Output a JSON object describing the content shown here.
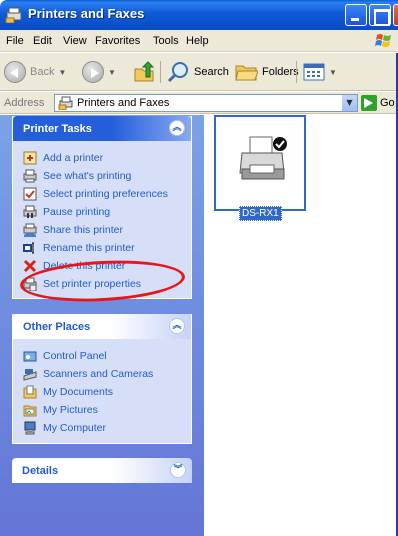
{
  "window": {
    "title": "Printers and Faxes"
  },
  "menu": [
    "File",
    "Edit",
    "View",
    "Favorites",
    "Tools",
    "Help"
  ],
  "toolbar": {
    "back": "Back",
    "search": "Search",
    "folders": "Folders"
  },
  "address": {
    "label": "Address",
    "value": "Printers and Faxes",
    "go": "Go"
  },
  "printer_tasks": {
    "title": "Printer Tasks",
    "items": [
      {
        "label": "Add a printer",
        "icon": "add-printer-icon"
      },
      {
        "label": "See what's printing",
        "icon": "print-queue-icon"
      },
      {
        "label": "Select printing preferences",
        "icon": "preferences-icon"
      },
      {
        "label": "Pause printing",
        "icon": "pause-icon"
      },
      {
        "label": "Share this printer",
        "icon": "share-icon"
      },
      {
        "label": "Rename this printer",
        "icon": "rename-icon"
      },
      {
        "label": "Delete this printer",
        "icon": "delete-icon"
      },
      {
        "label": "Set printer properties",
        "icon": "properties-icon"
      }
    ]
  },
  "other_places": {
    "title": "Other Places",
    "items": [
      {
        "label": "Control Panel",
        "icon": "control-panel-icon"
      },
      {
        "label": "Scanners and Cameras",
        "icon": "scanner-icon"
      },
      {
        "label": "My Documents",
        "icon": "folder-icon"
      },
      {
        "label": "My Pictures",
        "icon": "pictures-icon"
      },
      {
        "label": "My Computer",
        "icon": "computer-icon"
      }
    ]
  },
  "details": {
    "title": "Details"
  },
  "printer": {
    "name": "DS-RX1"
  },
  "colors": {
    "title_bar": "#0a4cc6",
    "task_link": "#215dc6",
    "annotation": "#e5171b"
  }
}
